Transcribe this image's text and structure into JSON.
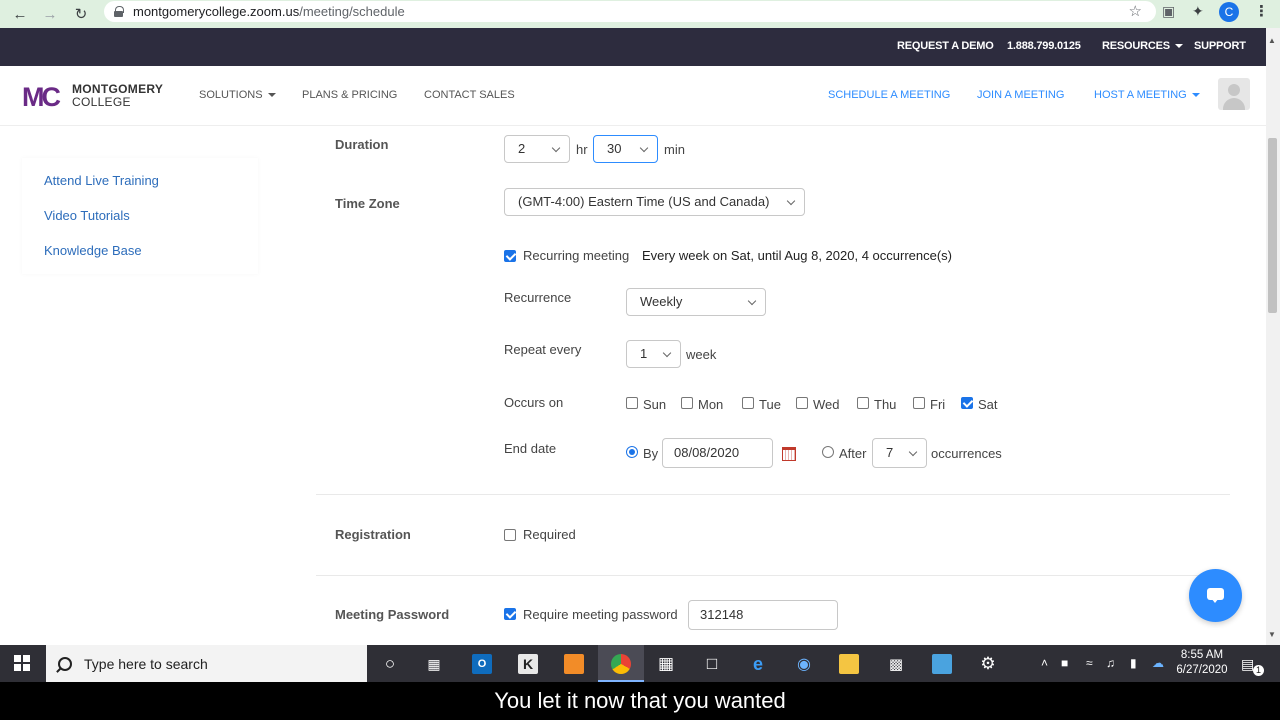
{
  "browser": {
    "url_host": "montgomerycollege.zoom.us",
    "url_path": "/meeting/schedule",
    "profile_initial": "C"
  },
  "topbar": {
    "request_demo": "REQUEST A DEMO",
    "phone": "1.888.799.0125",
    "resources": "RESOURCES",
    "support": "SUPPORT"
  },
  "header": {
    "logo_mark": "MC",
    "logo_line1": "MONTGOMERY",
    "logo_line2": "COLLEGE",
    "solutions": "SOLUTIONS",
    "plans": "PLANS & PRICING",
    "contact": "CONTACT SALES",
    "schedule": "SCHEDULE A MEETING",
    "join": "JOIN A MEETING",
    "host": "HOST A MEETING"
  },
  "sidebar": {
    "items": [
      "Attend Live Training",
      "Video Tutorials",
      "Knowledge Base"
    ]
  },
  "form": {
    "duration_label": "Duration",
    "duration_hours": "2",
    "hr_unit": "hr",
    "duration_minutes": "30",
    "min_unit": "min",
    "timezone_label": "Time Zone",
    "timezone_value": "(GMT-4:00) Eastern Time (US and Canada)",
    "recurring_label": "Recurring meeting",
    "recurring_summary": "Every week on Sat, until Aug 8, 2020, 4 occurrence(s)",
    "recurring_checked": true,
    "recurrence_label": "Recurrence",
    "recurrence_value": "Weekly",
    "repeat_label": "Repeat every",
    "repeat_value": "1",
    "repeat_unit": "week",
    "occurs_label": "Occurs on",
    "days": [
      {
        "label": "Sun",
        "checked": false
      },
      {
        "label": "Mon",
        "checked": false
      },
      {
        "label": "Tue",
        "checked": false
      },
      {
        "label": "Wed",
        "checked": false
      },
      {
        "label": "Thu",
        "checked": false
      },
      {
        "label": "Fri",
        "checked": false
      },
      {
        "label": "Sat",
        "checked": true
      }
    ],
    "end_label": "End date",
    "end_by_label": "By",
    "end_by_date": "08/08/2020",
    "end_after_label": "After",
    "end_after_value": "7",
    "occurrences_label": "occurrences",
    "registration_label": "Registration",
    "registration_required": "Required",
    "password_label": "Meeting Password",
    "password_checkbox": "Require meeting password",
    "password_value": "312148"
  },
  "taskbar": {
    "search_placeholder": "Type here to search",
    "time": "8:55 AM",
    "date": "6/27/2020",
    "notification_count": "1"
  },
  "caption": "You let it now that you wanted",
  "colors": {
    "topbar_bg": "#2d2c3e",
    "link_blue": "#2d8cff",
    "checkbox_blue": "#1a73e8"
  }
}
